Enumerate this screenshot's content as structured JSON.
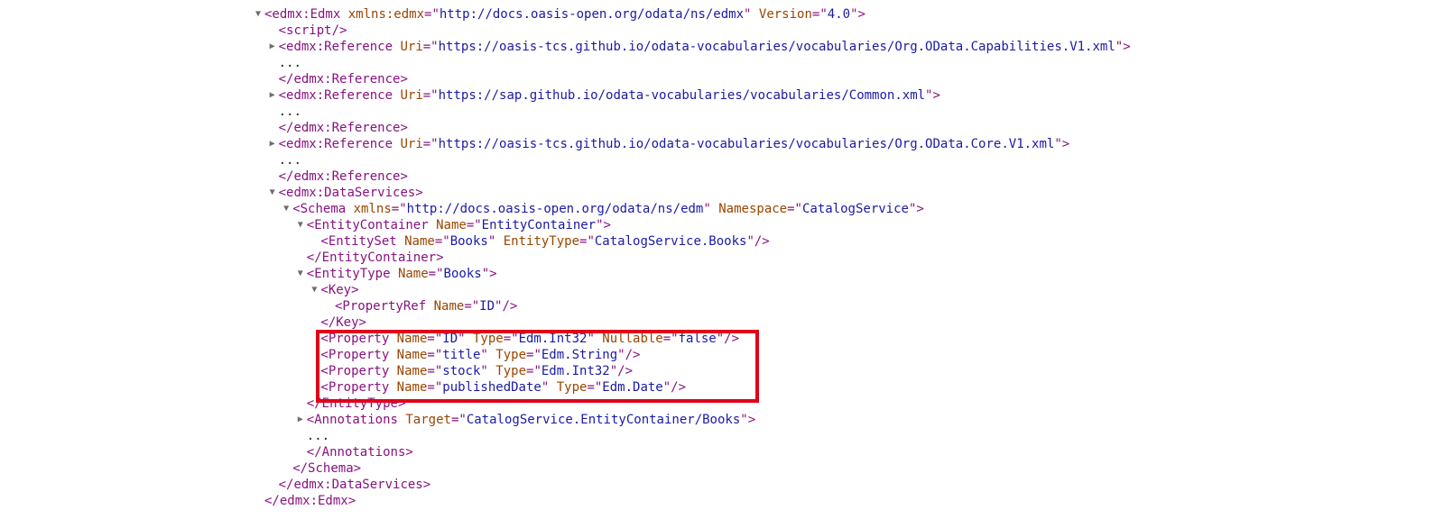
{
  "highlight_color": "#e0001b",
  "colors": {
    "tag": "#881280",
    "attribute": "#994500",
    "value": "#1a1aa6"
  },
  "lines": [
    {
      "indent": 0,
      "toggle": "expanded",
      "parts": [
        [
          "tag",
          "<edmx:Edmx"
        ],
        [
          "attr",
          " xmlns:edmx"
        ],
        [
          "tag",
          "=\""
        ],
        [
          "val",
          "http://docs.oasis-open.org/odata/ns/edmx"
        ],
        [
          "tag",
          "\""
        ],
        [
          "attr",
          " Version"
        ],
        [
          "tag",
          "=\""
        ],
        [
          "val",
          "4.0"
        ],
        [
          "tag",
          "\">"
        ]
      ]
    },
    {
      "indent": 1,
      "toggle": "none",
      "parts": [
        [
          "tag",
          "<script/>"
        ]
      ]
    },
    {
      "indent": 1,
      "toggle": "collapsed",
      "parts": [
        [
          "tag",
          "<edmx:Reference"
        ],
        [
          "attr",
          " Uri"
        ],
        [
          "tag",
          "=\""
        ],
        [
          "val",
          "https://oasis-tcs.github.io/odata-vocabularies/vocabularies/Org.OData.Capabilities.V1.xml"
        ],
        [
          "tag",
          "\">"
        ]
      ]
    },
    {
      "indent": 1,
      "toggle": "none",
      "parts": [
        [
          "ellipsis",
          "..."
        ]
      ]
    },
    {
      "indent": 1,
      "toggle": "none",
      "parts": [
        [
          "tag",
          "</edmx:Reference>"
        ]
      ]
    },
    {
      "indent": 1,
      "toggle": "collapsed",
      "parts": [
        [
          "tag",
          "<edmx:Reference"
        ],
        [
          "attr",
          " Uri"
        ],
        [
          "tag",
          "=\""
        ],
        [
          "val",
          "https://sap.github.io/odata-vocabularies/vocabularies/Common.xml"
        ],
        [
          "tag",
          "\">"
        ]
      ]
    },
    {
      "indent": 1,
      "toggle": "none",
      "parts": [
        [
          "ellipsis",
          "..."
        ]
      ]
    },
    {
      "indent": 1,
      "toggle": "none",
      "parts": [
        [
          "tag",
          "</edmx:Reference>"
        ]
      ]
    },
    {
      "indent": 1,
      "toggle": "collapsed",
      "parts": [
        [
          "tag",
          "<edmx:Reference"
        ],
        [
          "attr",
          " Uri"
        ],
        [
          "tag",
          "=\""
        ],
        [
          "val",
          "https://oasis-tcs.github.io/odata-vocabularies/vocabularies/Org.OData.Core.V1.xml"
        ],
        [
          "tag",
          "\">"
        ]
      ]
    },
    {
      "indent": 1,
      "toggle": "none",
      "parts": [
        [
          "ellipsis",
          "..."
        ]
      ]
    },
    {
      "indent": 1,
      "toggle": "none",
      "parts": [
        [
          "tag",
          "</edmx:Reference>"
        ]
      ]
    },
    {
      "indent": 1,
      "toggle": "expanded",
      "parts": [
        [
          "tag",
          "<edmx:DataServices>"
        ]
      ]
    },
    {
      "indent": 2,
      "toggle": "expanded",
      "parts": [
        [
          "tag",
          "<Schema"
        ],
        [
          "attr",
          " xmlns"
        ],
        [
          "tag",
          "=\""
        ],
        [
          "val",
          "http://docs.oasis-open.org/odata/ns/edm"
        ],
        [
          "tag",
          "\""
        ],
        [
          "attr",
          " Namespace"
        ],
        [
          "tag",
          "=\""
        ],
        [
          "val",
          "CatalogService"
        ],
        [
          "tag",
          "\">"
        ]
      ]
    },
    {
      "indent": 3,
      "toggle": "expanded",
      "parts": [
        [
          "tag",
          "<EntityContainer"
        ],
        [
          "attr",
          " Name"
        ],
        [
          "tag",
          "=\""
        ],
        [
          "val",
          "EntityContainer"
        ],
        [
          "tag",
          "\">"
        ]
      ]
    },
    {
      "indent": 4,
      "toggle": "none",
      "parts": [
        [
          "tag",
          "<EntitySet"
        ],
        [
          "attr",
          " Name"
        ],
        [
          "tag",
          "=\""
        ],
        [
          "val",
          "Books"
        ],
        [
          "tag",
          "\""
        ],
        [
          "attr",
          " EntityType"
        ],
        [
          "tag",
          "=\""
        ],
        [
          "val",
          "CatalogService.Books"
        ],
        [
          "tag",
          "\"/>"
        ]
      ]
    },
    {
      "indent": 3,
      "toggle": "none",
      "parts": [
        [
          "tag",
          "</EntityContainer>"
        ]
      ]
    },
    {
      "indent": 3,
      "toggle": "expanded",
      "parts": [
        [
          "tag",
          "<EntityType"
        ],
        [
          "attr",
          " Name"
        ],
        [
          "tag",
          "=\""
        ],
        [
          "val",
          "Books"
        ],
        [
          "tag",
          "\">"
        ]
      ]
    },
    {
      "indent": 4,
      "toggle": "expanded",
      "parts": [
        [
          "tag",
          "<Key>"
        ]
      ]
    },
    {
      "indent": 5,
      "toggle": "none",
      "parts": [
        [
          "tag",
          "<PropertyRef"
        ],
        [
          "attr",
          " Name"
        ],
        [
          "tag",
          "=\""
        ],
        [
          "val",
          "ID"
        ],
        [
          "tag",
          "\"/>"
        ]
      ]
    },
    {
      "indent": 4,
      "toggle": "none",
      "parts": [
        [
          "tag",
          "</Key>"
        ]
      ]
    },
    {
      "indent": 4,
      "toggle": "none",
      "parts": [
        [
          "tag",
          "<Property"
        ],
        [
          "attr",
          " Name"
        ],
        [
          "tag",
          "=\""
        ],
        [
          "val",
          "ID"
        ],
        [
          "tag",
          "\""
        ],
        [
          "attr",
          " Type"
        ],
        [
          "tag",
          "=\""
        ],
        [
          "val",
          "Edm.Int32"
        ],
        [
          "tag",
          "\""
        ],
        [
          "attr",
          " Nullable"
        ],
        [
          "tag",
          "=\""
        ],
        [
          "val",
          "false"
        ],
        [
          "tag",
          "\"/>"
        ]
      ]
    },
    {
      "indent": 4,
      "toggle": "none",
      "parts": [
        [
          "tag",
          "<Property"
        ],
        [
          "attr",
          " Name"
        ],
        [
          "tag",
          "=\""
        ],
        [
          "val",
          "title"
        ],
        [
          "tag",
          "\""
        ],
        [
          "attr",
          " Type"
        ],
        [
          "tag",
          "=\""
        ],
        [
          "val",
          "Edm.String"
        ],
        [
          "tag",
          "\"/>"
        ]
      ]
    },
    {
      "indent": 4,
      "toggle": "none",
      "parts": [
        [
          "tag",
          "<Property"
        ],
        [
          "attr",
          " Name"
        ],
        [
          "tag",
          "=\""
        ],
        [
          "val",
          "stock"
        ],
        [
          "tag",
          "\""
        ],
        [
          "attr",
          " Type"
        ],
        [
          "tag",
          "=\""
        ],
        [
          "val",
          "Edm.Int32"
        ],
        [
          "tag",
          "\"/>"
        ]
      ]
    },
    {
      "indent": 4,
      "toggle": "none",
      "parts": [
        [
          "tag",
          "<Property"
        ],
        [
          "attr",
          " Name"
        ],
        [
          "tag",
          "=\""
        ],
        [
          "val",
          "publishedDate"
        ],
        [
          "tag",
          "\""
        ],
        [
          "attr",
          " Type"
        ],
        [
          "tag",
          "=\""
        ],
        [
          "val",
          "Edm.Date"
        ],
        [
          "tag",
          "\"/>"
        ]
      ]
    },
    {
      "indent": 3,
      "toggle": "none",
      "parts": [
        [
          "tag",
          "</EntityType>"
        ]
      ]
    },
    {
      "indent": 3,
      "toggle": "collapsed",
      "parts": [
        [
          "tag",
          "<Annotations"
        ],
        [
          "attr",
          " Target"
        ],
        [
          "tag",
          "=\""
        ],
        [
          "val",
          "CatalogService.EntityContainer/Books"
        ],
        [
          "tag",
          "\">"
        ]
      ]
    },
    {
      "indent": 3,
      "toggle": "none",
      "parts": [
        [
          "ellipsis",
          "..."
        ]
      ]
    },
    {
      "indent": 3,
      "toggle": "none",
      "parts": [
        [
          "tag",
          "</Annotations>"
        ]
      ]
    },
    {
      "indent": 2,
      "toggle": "none",
      "parts": [
        [
          "tag",
          "</Schema>"
        ]
      ]
    },
    {
      "indent": 1,
      "toggle": "none",
      "parts": [
        [
          "tag",
          "</edmx:DataServices>"
        ]
      ]
    },
    {
      "indent": 0,
      "toggle": "none",
      "parts": [
        [
          "tag",
          "</edmx:Edmx>"
        ]
      ]
    }
  ]
}
